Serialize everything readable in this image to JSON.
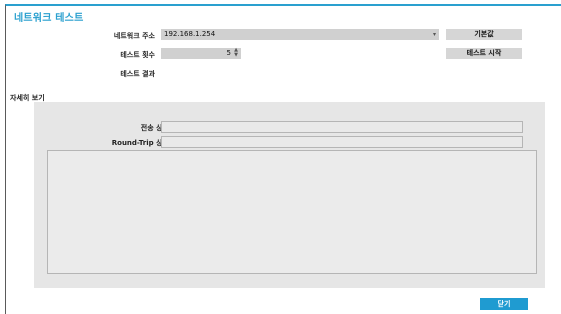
{
  "dialog": {
    "title": "네트워크 테스트"
  },
  "form": {
    "address_label": "네트워크 주소",
    "address_value": "192.168.1.254",
    "default_button": "기본값",
    "count_label": "테스트 횟수",
    "count_value": "5",
    "start_button": "테스트 시작",
    "result_label": "테스트 결과"
  },
  "detail": {
    "section_title": "자세히 보기",
    "transmit_label": "전송 상태",
    "rtt_label": "Round-Trip 상태"
  },
  "footer": {
    "close_button": "닫기"
  },
  "colors": {
    "accent": "#2aa0cf",
    "close_button": "#1f9bd1"
  }
}
